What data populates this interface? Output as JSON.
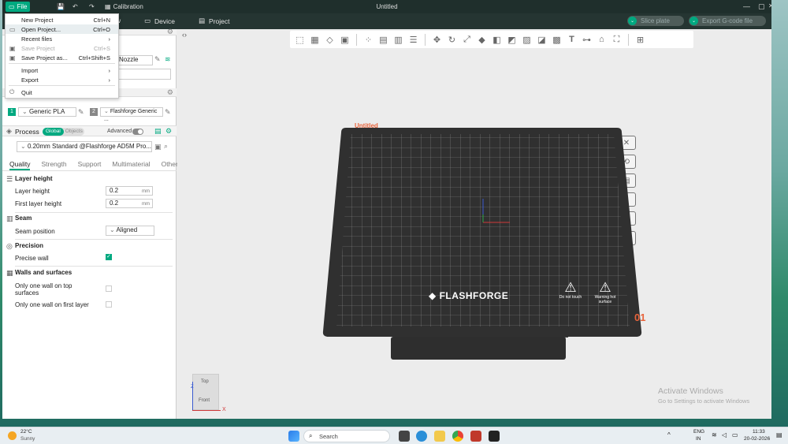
{
  "app": {
    "title": "Untitled",
    "file_label": "File",
    "calibration_label": "Calibration"
  },
  "nav": {
    "tab_partial": "w",
    "device_label": "Device",
    "project_label": "Project",
    "slice_label": "Slice plate",
    "export_label": "Export G-code file"
  },
  "file_menu": {
    "items": [
      {
        "label": "New Project",
        "shortcut": "Ctrl+N"
      },
      {
        "label": "Open Project...",
        "shortcut": "Ctrl+O"
      },
      {
        "label": "Recent files",
        "shortcut": "›"
      },
      {
        "label": "Save Project",
        "shortcut": "Ctrl+S"
      },
      {
        "label": "Save Project as...",
        "shortcut": "Ctrl+Shift+S"
      },
      {
        "label": "Import",
        "shortcut": "›"
      },
      {
        "label": "Export",
        "shortcut": "›"
      },
      {
        "label": "Quit",
        "shortcut": ""
      }
    ]
  },
  "printer": {
    "nozzle_label": "Nozzle"
  },
  "filament": {
    "slot1_num": "1",
    "slot1_name": "Generic PLA",
    "slot2_num": "2",
    "slot2_name": "Flashforge Generic ..."
  },
  "process": {
    "title": "Process",
    "global_label": "Global",
    "objects_label": "Objects",
    "advanced_label": "Advanced",
    "preset": "0.20mm Standard @Flashforge AD5M Pro...",
    "tabs": [
      "Quality",
      "Strength",
      "Support",
      "Multimaterial",
      "Others"
    ]
  },
  "settings": {
    "layer_height_head": "Layer height",
    "layer_height_label": "Layer height",
    "layer_height_value": "0.2",
    "first_layer_label": "First layer height",
    "first_layer_value": "0.2",
    "unit_mm": "mm",
    "seam_head": "Seam",
    "seam_position_label": "Seam position",
    "seam_position_value": "Aligned",
    "precision_head": "Precision",
    "precise_wall_label": "Precise wall",
    "walls_head": "Walls and surfaces",
    "one_wall_top_label": "Only one wall on top surfaces",
    "one_wall_first_label": "Only one wall on first layer"
  },
  "viewport": {
    "plate_name": "Untitled",
    "plate_number": "01",
    "brand": "FLASHFORGE",
    "warn1": "Do not touch",
    "warn2": "Warning hot surface",
    "cube_top": "Top",
    "cube_front": "Front",
    "axis_z": "Z",
    "axis_x": "X",
    "activate_title": "Activate Windows",
    "activate_sub": "Go to Settings to activate Windows"
  },
  "taskbar": {
    "temp": "22°C",
    "weather": "Sunny",
    "search": "Search",
    "lang1": "ENG",
    "lang2": "IN",
    "time": "11:33",
    "date": "20-02-2026"
  },
  "colors": {
    "accent": "#00a980",
    "plate": "#2d2d2d",
    "plate_num": "#e8643c"
  }
}
